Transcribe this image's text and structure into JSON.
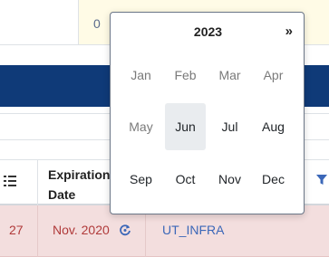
{
  "background": {
    "top_value": "0",
    "header": {
      "expiration_label": "Expiration Date"
    },
    "row": {
      "number": "27",
      "date": "Nov. 2020",
      "link": "UT_INFRA"
    }
  },
  "datepicker": {
    "year": "2023",
    "next_label": "»",
    "selected_month": "Jun",
    "months": [
      "Jan",
      "Feb",
      "Mar",
      "Apr",
      "May",
      "Jun",
      "Jul",
      "Aug",
      "Sep",
      "Oct",
      "Nov",
      "Dec"
    ]
  },
  "colors": {
    "navy_bar": "#0f3a78",
    "row_highlight": "#f3dede",
    "link": "#3b67b8",
    "danger_text": "#b03a3a"
  }
}
